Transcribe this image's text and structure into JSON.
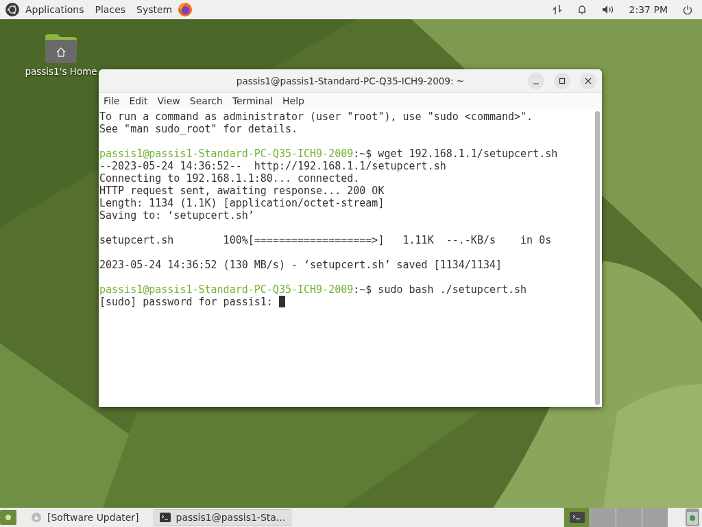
{
  "top_panel": {
    "menus": [
      "Applications",
      "Places",
      "System"
    ],
    "clock": "2:37 PM"
  },
  "desktop_icons": [
    {
      "label": "passis1's Home"
    }
  ],
  "window": {
    "title": "passis1@passis1-Standard-PC-Q35-ICH9-2009: ~",
    "menu": [
      "File",
      "Edit",
      "View",
      "Search",
      "Terminal",
      "Help"
    ],
    "lines": [
      {
        "kind": "output",
        "text": "To run a command as administrator (user \"root\"), use \"sudo <command>\"."
      },
      {
        "kind": "output",
        "text": "See \"man sudo_root\" for details."
      },
      {
        "kind": "blank"
      },
      {
        "kind": "prompt",
        "host": "passis1@passis1-Standard-PC-Q35-ICH9-2009",
        "path": ":~$",
        "text": "wget 192.168.1.1/setupcert.sh"
      },
      {
        "kind": "output",
        "text": "--2023-05-24 14:36:52--  http://192.168.1.1/setupcert.sh"
      },
      {
        "kind": "output",
        "text": "Connecting to 192.168.1.1:80... connected."
      },
      {
        "kind": "output",
        "text": "HTTP request sent, awaiting response... 200 OK"
      },
      {
        "kind": "output",
        "text": "Length: 1134 (1.1K) [application/octet-stream]"
      },
      {
        "kind": "output",
        "text": "Saving to: ‘setupcert.sh’"
      },
      {
        "kind": "blank"
      },
      {
        "kind": "output",
        "text": "setupcert.sh        100%[===================>]   1.11K  --.-KB/s    in 0s"
      },
      {
        "kind": "blank"
      },
      {
        "kind": "output",
        "text": "2023-05-24 14:36:52 (130 MB/s) - ‘setupcert.sh’ saved [1134/1134]"
      },
      {
        "kind": "blank"
      },
      {
        "kind": "prompt",
        "host": "passis1@passis1-Standard-PC-Q35-ICH9-2009",
        "path": ":~$",
        "text": "sudo bash ./setupcert.sh"
      },
      {
        "kind": "output",
        "text": "[sudo] password for passis1:",
        "cursor": true
      }
    ]
  },
  "taskbar": {
    "items": [
      {
        "label": "[Software Updater]",
        "selected": false
      },
      {
        "label": "passis1@passis1-Sta...",
        "selected": true
      }
    ],
    "workspaces": [
      {
        "selected": true
      },
      {
        "selected": false
      },
      {
        "selected": false
      },
      {
        "selected": false
      }
    ]
  }
}
